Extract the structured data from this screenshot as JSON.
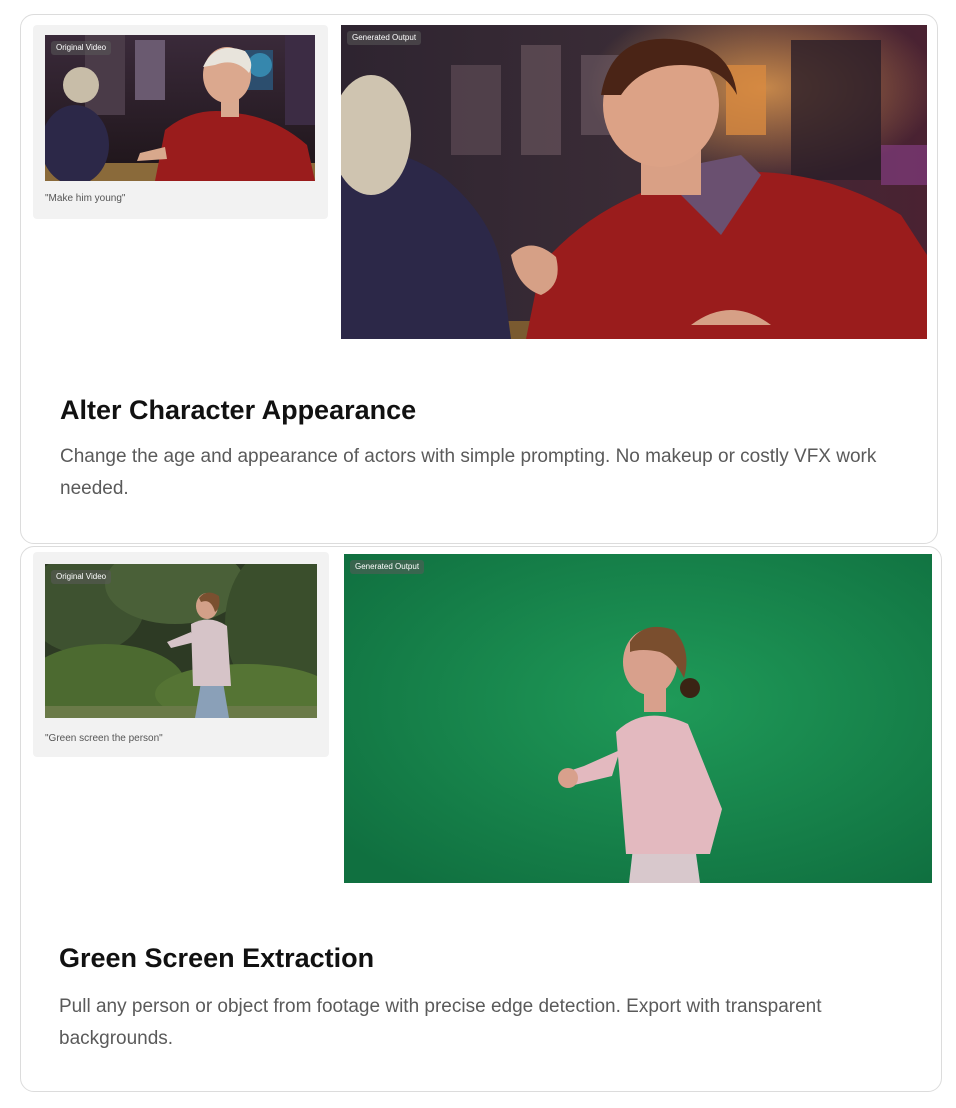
{
  "cards": [
    {
      "original_badge": "Original Video",
      "output_badge": "Generated Output",
      "prompt": "\"Make him young\"",
      "title": "Alter Character Appearance",
      "description": "Change the age and appearance of actors with simple prompting. No makeup or costly VFX work needed."
    },
    {
      "original_badge": "Original Video",
      "output_badge": "Generated Output",
      "prompt": "\"Green screen the person\"",
      "title": "Green Screen Extraction",
      "description": "Pull any person or object from footage with precise edge detection. Export with transparent backgrounds."
    }
  ],
  "colors": {
    "card_border": "#dcdcdc",
    "thumb_panel": "#f2f2f2",
    "title": "#111111",
    "description": "#5a5a5a",
    "green_screen": "#15834a",
    "sweater_red": "#9a1c1c",
    "hoodie_pink": "#e3b9bf"
  }
}
